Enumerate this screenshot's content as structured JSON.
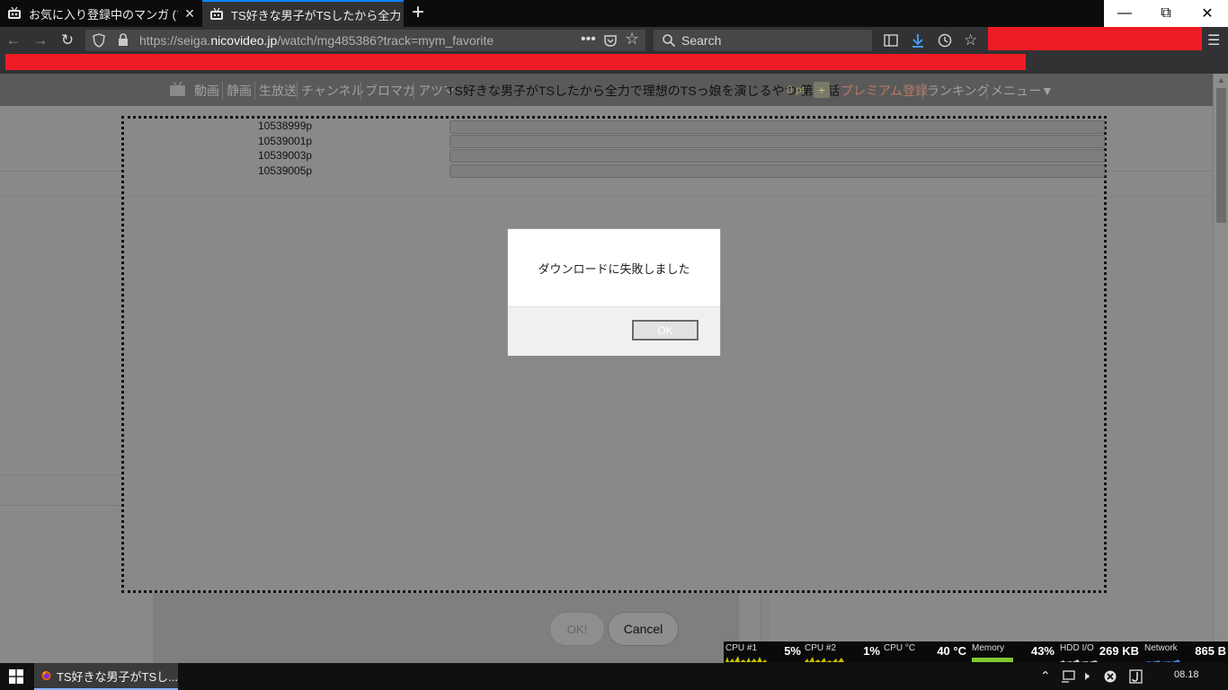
{
  "browser": {
    "tabs": [
      {
        "title": "お気に入り登録中のマンガ (マ"
      },
      {
        "title": "TS好きな男子がTSしたから全力"
      }
    ],
    "url_prefix": "https://seiga.",
    "url_domain": "nicovideo.jp",
    "url_path": "/watch/mg485386?track=mym_favorite",
    "search_placeholder": "Search"
  },
  "site_nav": {
    "items": [
      "動画",
      "静画",
      "生放送",
      "チャンネル",
      "ブロマガ",
      "アツマ"
    ],
    "page_title": "TS好きな男子がTSしたから全力で理想のTSっ娘を演じるやつ 第21話",
    "points": "0",
    "points_unit": "pt",
    "plus": "+",
    "premium": "プレミアム登録",
    "ranking": "ランキング",
    "menu": "メニュー▼"
  },
  "progress_rows": [
    {
      "label": "10538999p",
      "progress": 0
    },
    {
      "label": "10539001p",
      "progress": 0
    },
    {
      "label": "10539003p",
      "progress": 0
    },
    {
      "label": "10539005p",
      "progress": 0
    }
  ],
  "background_buttons": {
    "ok": "OK!",
    "cancel": "Cancel"
  },
  "dialog": {
    "message": "ダウンロードに失敗しました",
    "ok": "OK"
  },
  "sysmon": [
    {
      "label": "CPU #1",
      "value": "5%"
    },
    {
      "label": "CPU #2",
      "value": "1%"
    },
    {
      "label": "CPU °C",
      "value": "40 °C"
    },
    {
      "label": "Memory",
      "value": "43%"
    },
    {
      "label": "HDD I/O",
      "value": "269 KB"
    },
    {
      "label": "Network",
      "value": "865 B"
    }
  ],
  "taskbar": {
    "app_title": "TS好きな男子がTSし...",
    "clock": "08.18"
  },
  "colors": {
    "redaction": "#ed1c24",
    "accent": "#0a84ff"
  }
}
